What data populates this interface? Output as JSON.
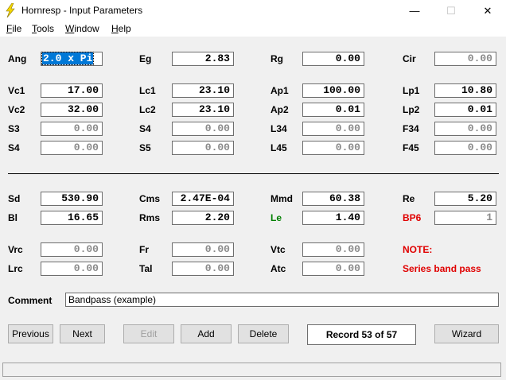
{
  "window": {
    "title": "Hornresp - Input Parameters",
    "minimize": "—",
    "maximize": "☐",
    "close": "✕",
    "icon": "lightning-icon"
  },
  "menu": [
    {
      "pre": "",
      "u": "F",
      "post": "ile"
    },
    {
      "pre": "",
      "u": "T",
      "post": "ools"
    },
    {
      "pre": "",
      "u": "W",
      "post": "indow"
    },
    {
      "pre": "",
      "u": "H",
      "post": "elp"
    }
  ],
  "params": {
    "ang": {
      "label": "Ang",
      "value": "2.0 x Pi"
    },
    "eg": {
      "label": "Eg",
      "value": "2.83"
    },
    "rg": {
      "label": "Rg",
      "value": "0.00"
    },
    "cir": {
      "label": "Cir",
      "value": "0.00"
    },
    "vc1": {
      "label": "Vc1",
      "value": "17.00"
    },
    "lc1": {
      "label": "Lc1",
      "value": "23.10"
    },
    "ap1": {
      "label": "Ap1",
      "value": "100.00"
    },
    "lp1": {
      "label": "Lp1",
      "value": "10.80"
    },
    "vc2": {
      "label": "Vc2",
      "value": "32.00"
    },
    "lc2": {
      "label": "Lc2",
      "value": "23.10"
    },
    "ap2": {
      "label": "Ap2",
      "value": "0.01"
    },
    "lp2": {
      "label": "Lp2",
      "value": "0.01"
    },
    "s3": {
      "label": "S3",
      "value": "0.00"
    },
    "s4a": {
      "label": "S4",
      "value": "0.00"
    },
    "l34": {
      "label": "L34",
      "value": "0.00"
    },
    "f34": {
      "label": "F34",
      "value": "0.00"
    },
    "s4b": {
      "label": "S4",
      "value": "0.00"
    },
    "s5": {
      "label": "S5",
      "value": "0.00"
    },
    "l45": {
      "label": "L45",
      "value": "0.00"
    },
    "f45": {
      "label": "F45",
      "value": "0.00"
    },
    "sd": {
      "label": "Sd",
      "value": "530.90"
    },
    "cms": {
      "label": "Cms",
      "value": "2.47E-04"
    },
    "mmd": {
      "label": "Mmd",
      "value": "60.38"
    },
    "re": {
      "label": "Re",
      "value": "5.20"
    },
    "bl": {
      "label": "Bl",
      "value": "16.65"
    },
    "rms": {
      "label": "Rms",
      "value": "2.20"
    },
    "le": {
      "label": "Le",
      "value": "1.40"
    },
    "bp6": {
      "label": "BP6",
      "value": "1"
    },
    "vrc": {
      "label": "Vrc",
      "value": "0.00"
    },
    "fr": {
      "label": "Fr",
      "value": "0.00"
    },
    "vtc": {
      "label": "Vtc",
      "value": "0.00"
    },
    "lrc": {
      "label": "Lrc",
      "value": "0.00"
    },
    "tal": {
      "label": "Tal",
      "value": "0.00"
    },
    "atc": {
      "label": "Atc",
      "value": "0.00"
    }
  },
  "note": {
    "title": "NOTE:",
    "text": "Series band pass"
  },
  "comment": {
    "label": "Comment",
    "value": "Bandpass (example)"
  },
  "buttons": {
    "previous": "Previous",
    "next": "Next",
    "edit": "Edit",
    "add": "Add",
    "delete": "Delete",
    "wizard": "Wizard"
  },
  "record": "Record 53 of 57",
  "colors": {
    "selection": "#0078d7",
    "note": "#e00000",
    "le_label": "#008000"
  }
}
